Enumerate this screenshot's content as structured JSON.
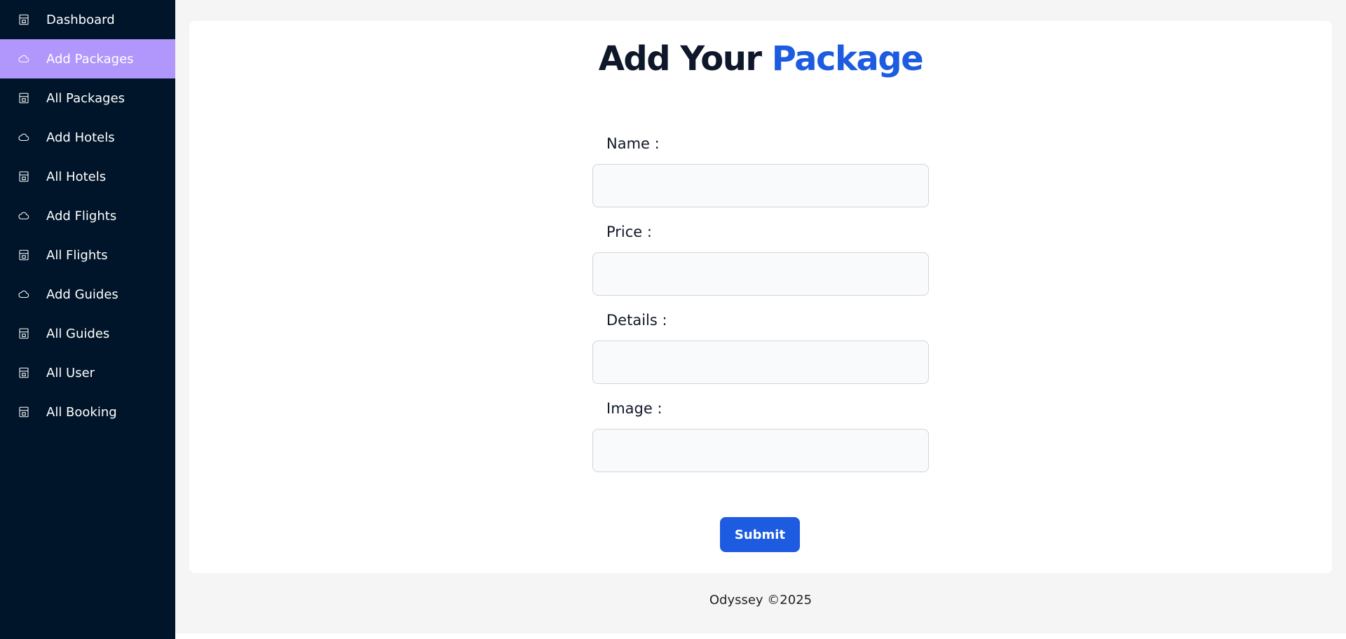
{
  "sidebar": {
    "items": [
      {
        "label": "Dashboard",
        "icon": "store-icon",
        "active": false
      },
      {
        "label": "Add Packages",
        "icon": "cloud-icon",
        "active": true
      },
      {
        "label": "All Packages",
        "icon": "store-icon",
        "active": false
      },
      {
        "label": "Add Hotels",
        "icon": "cloud-icon",
        "active": false
      },
      {
        "label": "All Hotels",
        "icon": "store-icon",
        "active": false
      },
      {
        "label": "Add Flights",
        "icon": "cloud-icon",
        "active": false
      },
      {
        "label": "All Flights",
        "icon": "store-icon",
        "active": false
      },
      {
        "label": "Add Guides",
        "icon": "cloud-icon",
        "active": false
      },
      {
        "label": "All Guides",
        "icon": "store-icon",
        "active": false
      },
      {
        "label": "All User",
        "icon": "store-icon",
        "active": false
      },
      {
        "label": "All Booking",
        "icon": "store-icon",
        "active": false
      }
    ]
  },
  "page": {
    "title_part1": "Add Your",
    "title_part2": "Package"
  },
  "form": {
    "name_label": "Name :",
    "name_value": "",
    "price_label": "Price :",
    "price_value": "",
    "details_label": "Details :",
    "details_value": "",
    "image_label": "Image :",
    "image_value": "",
    "submit_label": "Submit"
  },
  "footer": {
    "text": "Odyssey ©2025"
  },
  "colors": {
    "sidebar_bg": "#001529",
    "active_item": "#b197fc",
    "accent": "#1d5ce0"
  }
}
